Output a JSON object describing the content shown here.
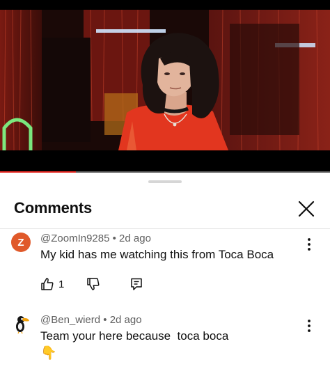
{
  "video": {
    "played_fraction": 0.23
  },
  "comments_panel": {
    "title": "Comments",
    "comments": [
      {
        "avatar_letter": "Z",
        "avatar_color": "#e0592a",
        "author": "@ZoomIn9285",
        "age": "2d ago",
        "text": "My kid has me watching this from Toca Boca",
        "likes": "1"
      },
      {
        "avatar_icon": "toucan-avatar-icon",
        "author": "@Ben_wierd",
        "age": "2d ago",
        "text": "Team your here because  toca boca",
        "text_line2": "👇"
      }
    ]
  }
}
